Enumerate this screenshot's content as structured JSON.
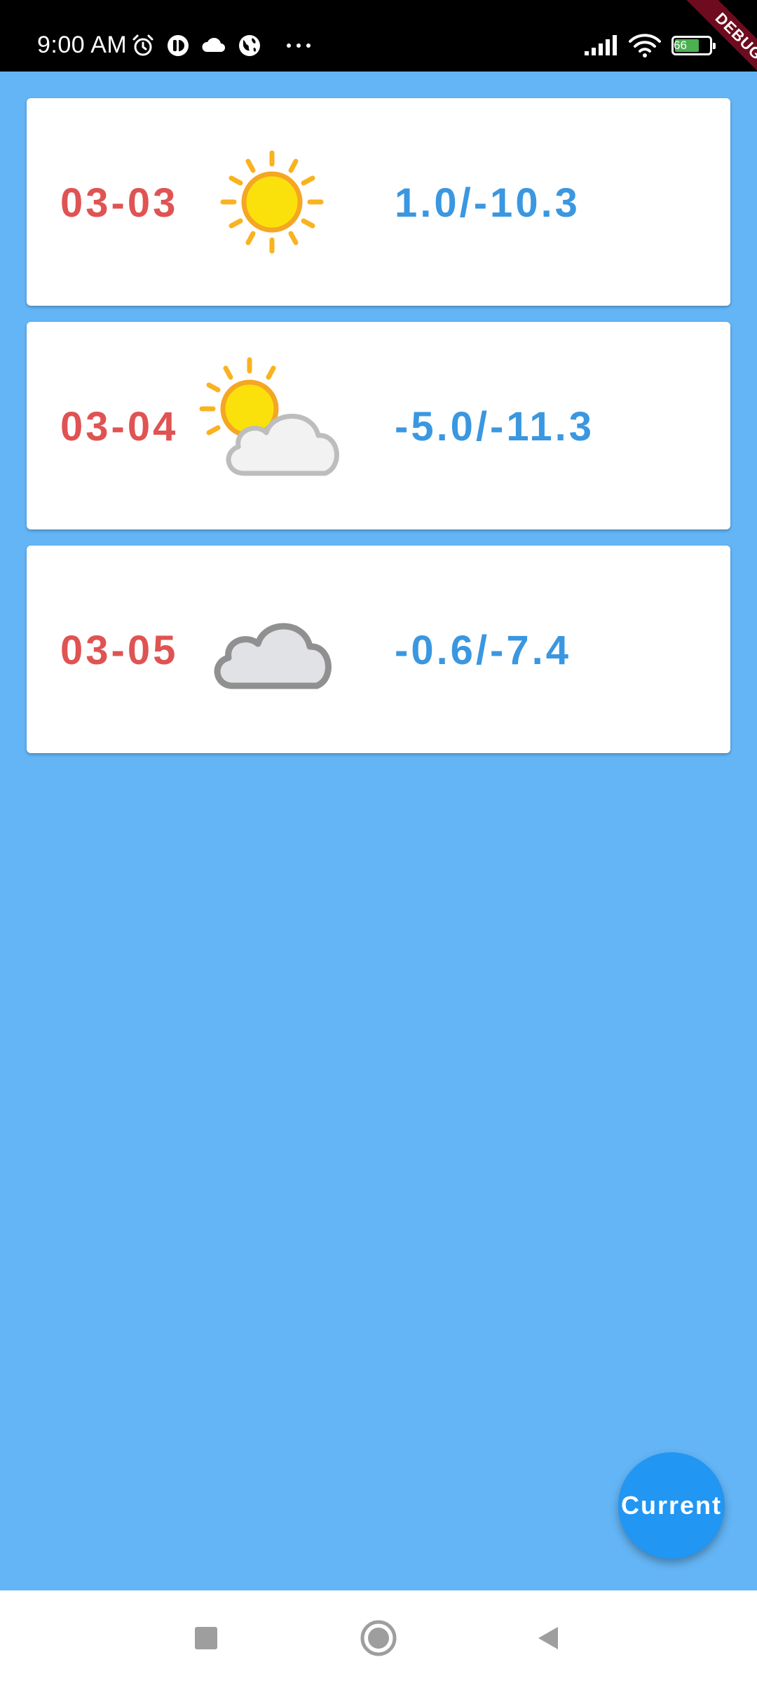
{
  "status_bar": {
    "time": "9:00 AM",
    "battery_level": "66",
    "left_icons": [
      "alarm-icon",
      "app-notification-icon",
      "cloud-icon",
      "globe-icon",
      "more-dots-icon"
    ],
    "right_icons": [
      "signal-icon",
      "wifi-icon",
      "battery-icon"
    ]
  },
  "debug_banner": {
    "label": "DEBUG"
  },
  "forecast": {
    "items": [
      {
        "date": "03-03",
        "icon": "sunny-icon",
        "temp": "1.0/-10.3"
      },
      {
        "date": "03-04",
        "icon": "partly-cloudy-icon",
        "temp": "-5.0/-11.3"
      },
      {
        "date": "03-05",
        "icon": "cloudy-icon",
        "temp": "-0.6/-7.4"
      }
    ]
  },
  "fab": {
    "label": "Current"
  },
  "nav_bar": {
    "buttons": [
      "recents-square-icon",
      "home-circle-icon",
      "back-triangle-icon"
    ]
  },
  "colors": {
    "background": "#64B5F6",
    "date_text": "#E05353",
    "temp_text": "#3A97E0",
    "fab": "#2196F3"
  }
}
